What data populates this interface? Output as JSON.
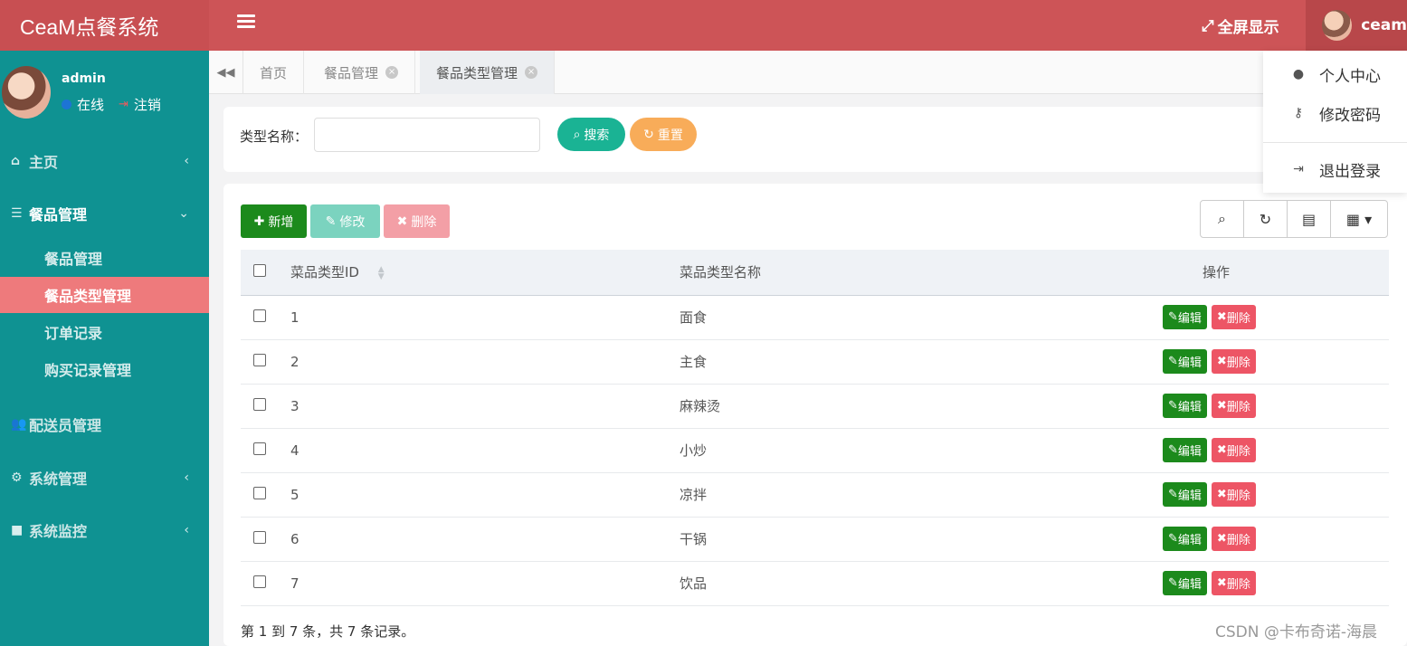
{
  "header": {
    "brand": "CeaM点餐系统",
    "fullscreen_label": "全屏显示",
    "username": "ceam"
  },
  "sidebar": {
    "profile_name": "admin",
    "status_label": "在线",
    "logout_label": "注销",
    "items": [
      {
        "label": "主页",
        "icon": "home-icon"
      },
      {
        "label": "餐品管理",
        "icon": "list-icon"
      },
      {
        "label": "配送员管理",
        "icon": "users-icon"
      },
      {
        "label": "系统管理",
        "icon": "gear-icon"
      },
      {
        "label": "系统监控",
        "icon": "video-icon"
      }
    ],
    "sub_items": [
      "餐品管理",
      "餐品类型管理",
      "订单记录",
      "购买记录管理"
    ]
  },
  "tabs": [
    "首页",
    "餐品管理",
    "餐品类型管理"
  ],
  "dropdown": [
    "个人中心",
    "修改密码",
    "退出登录"
  ],
  "search": {
    "label": "类型名称：",
    "value": "",
    "search_label": "搜索",
    "reset_label": "重置"
  },
  "toolbar": {
    "add_label": "新增",
    "edit_label": "修改",
    "delete_label": "删除"
  },
  "table": {
    "columns": [
      "菜品类型ID",
      "菜品类型名称",
      "操作"
    ],
    "edit_label": "编辑",
    "delete_label": "删除",
    "rows": [
      {
        "id": "1",
        "name": "面食"
      },
      {
        "id": "2",
        "name": "主食"
      },
      {
        "id": "3",
        "name": "麻辣烫"
      },
      {
        "id": "4",
        "name": "小炒"
      },
      {
        "id": "5",
        "name": "凉拌"
      },
      {
        "id": "6",
        "name": "干锅"
      },
      {
        "id": "7",
        "name": "饮品"
      }
    ]
  },
  "footer_info": "第 1 到 7 条，共 7 条记录。",
  "watermark": "CSDN @卡布奇诺-海晨",
  "colors": {
    "header": "#cd5457",
    "sidebar": "#0f9292",
    "active_item": "#ee7a7c",
    "primary": "#1ab394",
    "warning": "#f8ac59",
    "success": "#1c8a1c",
    "danger": "#ed5565"
  }
}
